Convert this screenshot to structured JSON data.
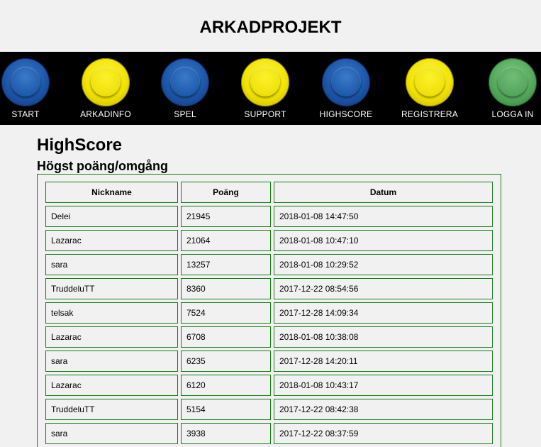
{
  "site": {
    "title": "ARKADPROJEKT"
  },
  "nav": {
    "items": [
      {
        "label": "START",
        "color": "blue"
      },
      {
        "label": "ARKADINFO",
        "color": "yellow"
      },
      {
        "label": "SPEL",
        "color": "blue"
      },
      {
        "label": "SUPPORT",
        "color": "yellow"
      },
      {
        "label": "HIGHSCORE",
        "color": "blue"
      },
      {
        "label": "REGISTRERA",
        "color": "yellow"
      },
      {
        "label": "LOGGA IN",
        "color": "green"
      }
    ]
  },
  "page": {
    "heading": "HighScore",
    "subheading": "Högst poäng/omgång"
  },
  "table": {
    "headers": {
      "nickname": "Nickname",
      "points": "Poäng",
      "date": "Datum"
    },
    "rows": [
      {
        "nickname": "Delei",
        "points": "21945",
        "date": "2018-01-08 14:47:50"
      },
      {
        "nickname": "Lazarac",
        "points": "21064",
        "date": "2018-01-08 10:47:10"
      },
      {
        "nickname": "sara",
        "points": "13257",
        "date": "2018-01-08 10:29:52"
      },
      {
        "nickname": "TruddeluTT",
        "points": "8360",
        "date": "2017-12-22 08:54:56"
      },
      {
        "nickname": "telsak",
        "points": "7524",
        "date": "2017-12-28 14:09:34"
      },
      {
        "nickname": "Lazarac",
        "points": "6708",
        "date": "2018-01-08 10:38:08"
      },
      {
        "nickname": "sara",
        "points": "6235",
        "date": "2017-12-28 14:20:11"
      },
      {
        "nickname": "Lazarac",
        "points": "6120",
        "date": "2018-01-08 10:43:17"
      },
      {
        "nickname": "TruddeluTT",
        "points": "5154",
        "date": "2017-12-22 08:42:38"
      },
      {
        "nickname": "sara",
        "points": "3938",
        "date": "2017-12-22 08:37:59"
      }
    ]
  },
  "colors": {
    "nav_background": "#000000",
    "page_background": "#f1f1f1",
    "table_border": "#1a7a1a",
    "button_blue": "#1c56a8",
    "button_yellow": "#f2e400",
    "button_green": "#54a95c"
  }
}
